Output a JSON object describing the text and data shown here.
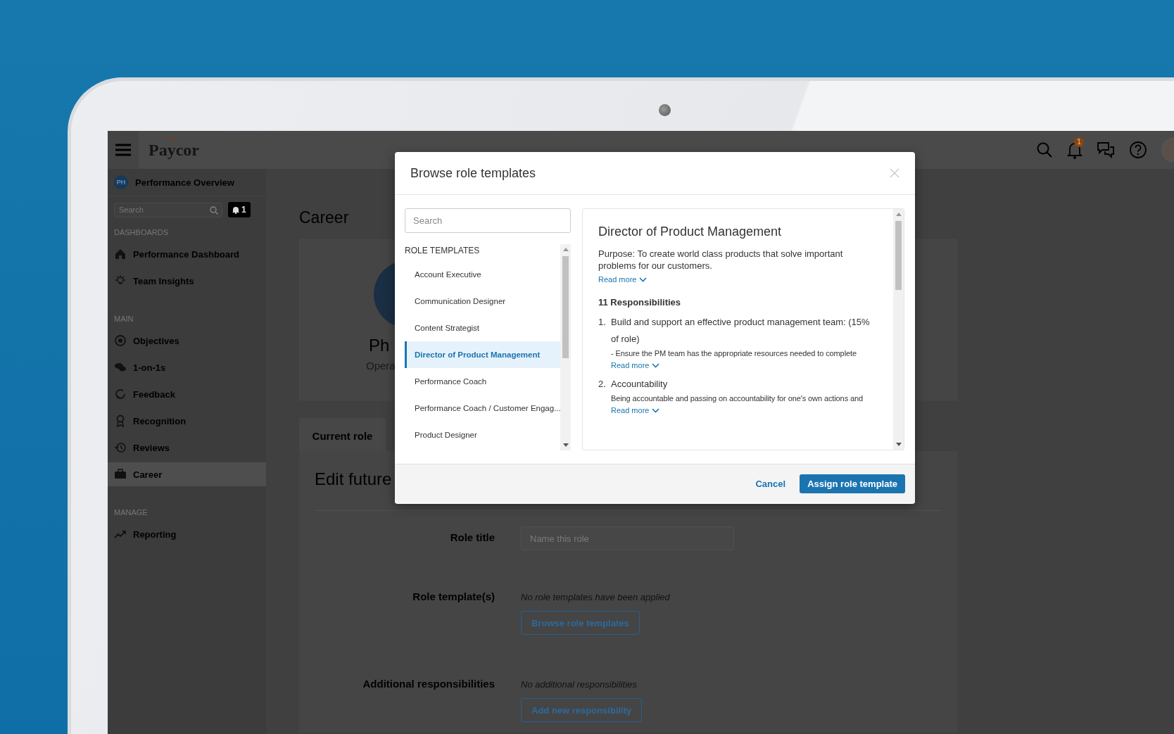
{
  "header": {
    "logo": "Paycor",
    "notification_count": "1"
  },
  "sidebar": {
    "profile": {
      "initials": "PH",
      "name": "Performance Overview"
    },
    "search": {
      "placeholder": "Search"
    },
    "alerts_count": "1",
    "sections": [
      {
        "title": "DASHBOARDS",
        "items": [
          {
            "label": "Performance Dashboard",
            "selected": false
          },
          {
            "label": "Team Insights",
            "selected": false
          }
        ]
      },
      {
        "title": "MAIN",
        "items": [
          {
            "label": "Objectives",
            "selected": false
          },
          {
            "label": "1-on-1s",
            "selected": false
          },
          {
            "label": "Feedback",
            "selected": false
          },
          {
            "label": "Recognition",
            "selected": false
          },
          {
            "label": "Reviews",
            "selected": false
          },
          {
            "label": "Career",
            "selected": true
          }
        ]
      },
      {
        "title": "MANAGE",
        "items": [
          {
            "label": "Reporting",
            "selected": false
          }
        ]
      }
    ]
  },
  "main": {
    "title": "Career",
    "profile": {
      "name": "Ph",
      "subtitle": "Opera"
    },
    "tabs": [
      {
        "label": "Current role",
        "selected": false
      }
    ],
    "form": {
      "heading": "Edit future",
      "rows": [
        {
          "kind": "input",
          "label": "Role title",
          "placeholder": "Name this role"
        },
        {
          "kind": "action",
          "label": "Role template(s)",
          "note": "No role templates have been applied",
          "button": "Browse role templates"
        },
        {
          "kind": "action",
          "label": "Additional responsibilities",
          "note": "No additional responsibilities",
          "button": "Add new responsibility"
        }
      ]
    }
  },
  "modal": {
    "title": "Browse role templates",
    "search": {
      "placeholder": "Search"
    },
    "list_heading": "ROLE TEMPLATES",
    "templates": [
      {
        "label": "Account Executive",
        "selected": false
      },
      {
        "label": "Communication Designer",
        "selected": false
      },
      {
        "label": "Content Strategist",
        "selected": false
      },
      {
        "label": "Director of Product Management",
        "selected": true
      },
      {
        "label": "Performance Coach",
        "selected": false
      },
      {
        "label": "Performance Coach / Customer Engag...",
        "selected": false
      },
      {
        "label": "Product Designer",
        "selected": false
      }
    ],
    "detail": {
      "title": "Director of Product Management",
      "purpose": "Purpose: To create world class products that solve important problems for our customers.",
      "read_more": "Read more",
      "responsibilities_heading": "11 Responsibilities",
      "responsibilities": [
        {
          "number": "1.",
          "title": "Build and support an effective product management team: (15% of role)",
          "description": "- Ensure the PM team has the appropriate resources needed to complete",
          "read_more": "Read more"
        },
        {
          "number": "2.",
          "title": "Accountability",
          "description": "Being accountable and passing on accountability for one's own actions and",
          "read_more": "Read more"
        }
      ]
    },
    "buttons": {
      "cancel": "Cancel",
      "confirm": "Assign role template"
    }
  }
}
